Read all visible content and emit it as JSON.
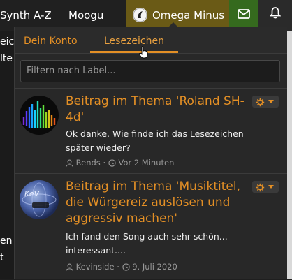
{
  "navbar": {
    "synth_label": "Synth A-Z",
    "moog_label": "Moogu",
    "user_label": "Omega Minus",
    "mail_icon": "envelope-icon",
    "bell_icon": "bell-icon",
    "colors": {
      "user_bg": "#6a5a16",
      "mail_bg": "#356a1e",
      "bell_bg": "#2a2a2a"
    }
  },
  "background": {
    "fragments": [
      "eic",
      "lte",
      "en",
      "t"
    ]
  },
  "dropdown": {
    "tabs": [
      {
        "label": "Dein Konto",
        "active": false
      },
      {
        "label": "Lesezeichen",
        "active": true
      }
    ],
    "filter_placeholder": "Filtern nach Label...",
    "items": [
      {
        "title": "Beitrag im Thema 'Roland SH-4d'",
        "title_lines": [
          "Beitrag im Thema 'Roland SH-",
          "4d'"
        ],
        "text_lines": [
          "Ok danke. Wie finde ich das Lesezeichen",
          "später wieder?"
        ],
        "author": "Rends",
        "time": "Vor 2 Minuten",
        "avatar_icon": "equalizer-avatar"
      },
      {
        "title": "Beitrag im Thema 'Musiktitel, die Würgereiz auslösen und aggressiv machen'",
        "title_lines": [
          "Beitrag im Thema 'Musiktitel,",
          "die Würgereiz auslösen und",
          "aggressiv machen'"
        ],
        "text_lines": [
          "Ich fand den Song auch sehr schön...",
          "interessant...."
        ],
        "author": "Kevinside",
        "time": "9. Juli 2020",
        "avatar_icon": "kev-avatar"
      }
    ]
  },
  "colors": {
    "accent": "#e38f25",
    "panel": "#282828",
    "page": "#1f1f1f"
  }
}
